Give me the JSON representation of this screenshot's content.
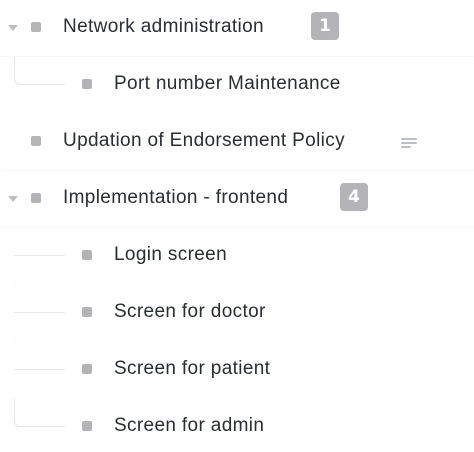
{
  "tasks": [
    {
      "name": "Network administration",
      "subtask_count": "1",
      "expanded": true,
      "status_color": "#b3b3b8",
      "subtasks": [
        {
          "name": "Port number Maintenance",
          "status_color": "#b3b3b8"
        }
      ]
    },
    {
      "name": "Updation of Endorsement Policy",
      "has_description": true,
      "icon": "description-lines-icon",
      "status_color": "#b3b3b8"
    },
    {
      "name": "Implementation - frontend",
      "subtask_count": "4",
      "expanded": true,
      "status_color": "#b3b3b8",
      "subtasks": [
        {
          "name": "Login screen",
          "status_color": "#b3b3b8"
        },
        {
          "name": "Screen for doctor",
          "status_color": "#b3b3b8"
        },
        {
          "name": "Screen for patient",
          "status_color": "#b3b3b8"
        },
        {
          "name": "Screen for admin",
          "status_color": "#b3b3b8"
        }
      ]
    }
  ],
  "colors": {
    "text": "#292d34",
    "status_gray": "#b3b3b8",
    "tree_line": "#e4e6ea",
    "caret": "#b9bec7"
  }
}
